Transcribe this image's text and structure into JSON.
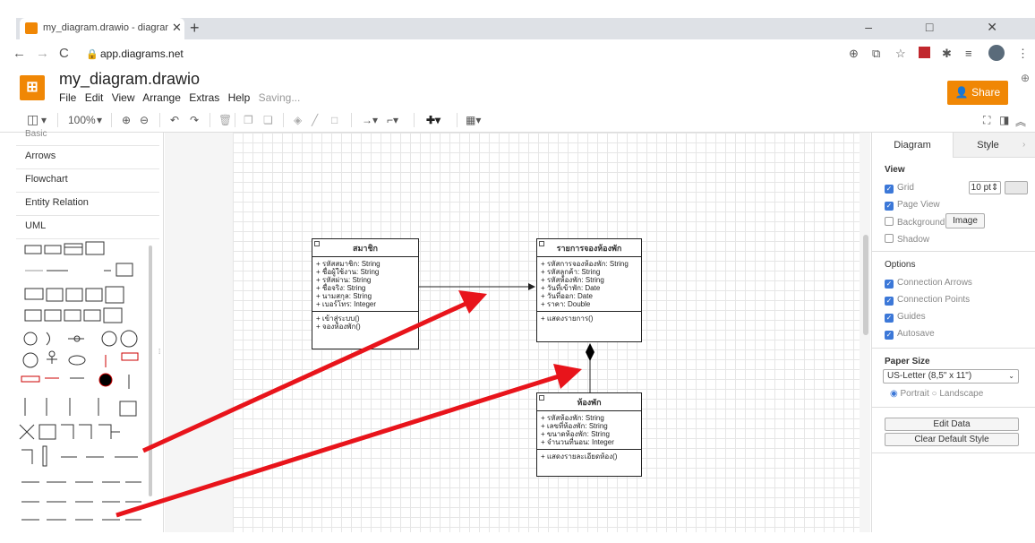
{
  "browser": {
    "tab_title": "my_diagram.drawio - diagrams.n",
    "tab_close": "✕",
    "new_tab": "+",
    "window_controls": "–  □  ✕",
    "url": "app.diagrams.net",
    "back": "←",
    "forward": "→",
    "reload": "C"
  },
  "app": {
    "filename": "my_diagram.drawio",
    "menus": [
      "File",
      "Edit",
      "View",
      "Arrange",
      "Extras",
      "Help"
    ],
    "saving": "Saving...",
    "share_label": "Share"
  },
  "toolbar": {
    "zoom": "100%"
  },
  "sidebar": {
    "clipped": "Basic",
    "items": [
      "Arrows",
      "Flowchart",
      "Entity Relation",
      "UML"
    ]
  },
  "diagram": {
    "classes": [
      {
        "title": "สมาชิก",
        "attributes": [
          "+ รหัสสมาชิก: String",
          "+ ชื่อผู้ใช้งาน: String",
          "+ รหัสผ่าน: String",
          "+ ชื่อจริง: String",
          "+ นามสกุล: String",
          "+ เบอร์โทร: Integer"
        ],
        "operations": [
          "+ เข้าสู่ระบบ()",
          "+ จองห้องพัก()"
        ]
      },
      {
        "title": "รายการจองห้องพัก",
        "attributes": [
          "+ รหัสการจองห้องพัก: String",
          "+ รหัสลูกค้า: String",
          "+ รหัสห้องพัก: String",
          "+ วันที่เข้าพัก: Date",
          "+ วันที่ออก: Date",
          "+ ราคา: Double"
        ],
        "operations": [
          "+ แสดงรายการ()"
        ]
      },
      {
        "title": "ห้องพัก",
        "attributes": [
          "+ รหัสห้องพัก: String",
          "+ เลขที่ห้องพัก: String",
          "+ ขนาดห้องพัก: String",
          "+ จำนวนที่นอน: Integer"
        ],
        "operations": [
          "+ แสดงรายละเอียดห้อง()"
        ]
      }
    ]
  },
  "panel": {
    "tabs": [
      "Diagram",
      "Style"
    ],
    "view_heading": "View",
    "grid": {
      "label": "Grid",
      "checked": true,
      "size": "10 pt"
    },
    "page_view": {
      "label": "Page View",
      "checked": true
    },
    "background": {
      "label": "Background",
      "checked": false,
      "button": "Image"
    },
    "shadow": {
      "label": "Shadow",
      "checked": false
    },
    "options_heading": "Options",
    "options": [
      {
        "label": "Connection Arrows",
        "checked": true
      },
      {
        "label": "Connection Points",
        "checked": true
      },
      {
        "label": "Guides",
        "checked": true
      },
      {
        "label": "Autosave",
        "checked": true
      }
    ],
    "paper_heading": "Paper Size",
    "paper_size": "US-Letter (8,5\" x 11\")",
    "orientation": {
      "portrait": "Portrait",
      "landscape": "Landscape",
      "selected": "Portrait"
    },
    "edit_data": "Edit Data",
    "clear_style": "Clear Default Style"
  },
  "colors": {
    "accent": "#f08705",
    "checkbox": "#3c78d8",
    "annotation_arrow": "#e8141b"
  }
}
